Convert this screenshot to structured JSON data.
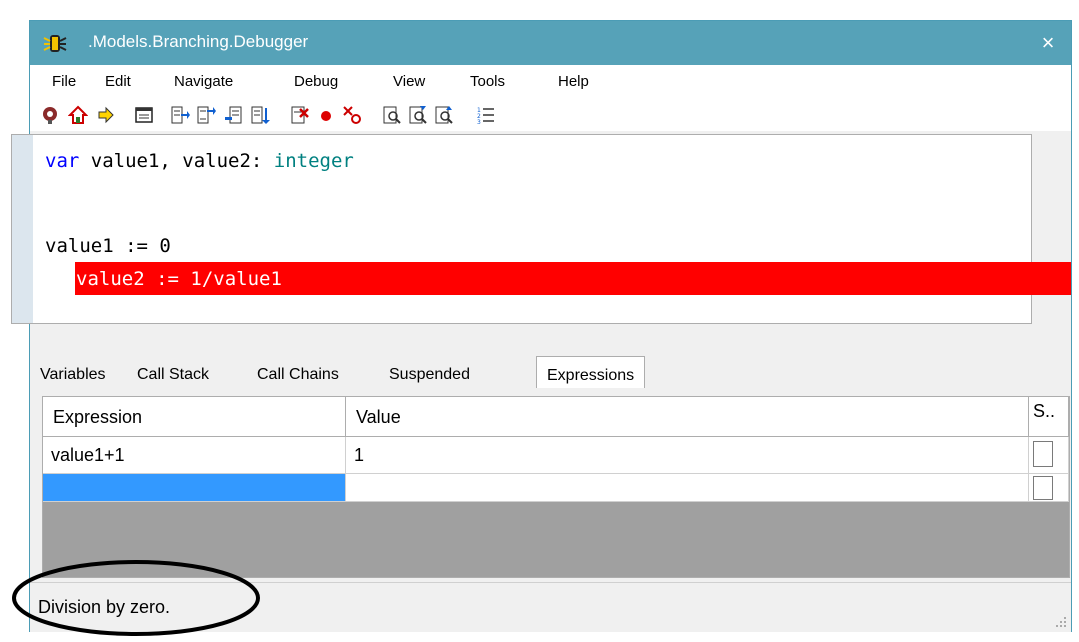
{
  "window": {
    "title": ".Models.Branching.Debugger",
    "close": "×"
  },
  "menu": [
    "File",
    "Edit",
    "Navigate",
    "Debug",
    "View",
    "Tools",
    "Help"
  ],
  "toolbar": [
    "breakpoint-icon",
    "home-icon",
    "run-arrow-icon",
    "window-icon",
    "step-into-icon",
    "step-over-icon",
    "step-out-icon",
    "run-to-cursor-icon",
    "stop-icon",
    "breakpoint-dot-icon",
    "clear-breakpoints-icon",
    "find-icon",
    "find-next-icon",
    "find-prev-icon",
    "list-icon"
  ],
  "code": {
    "line1": {
      "kw": "var",
      "mid": " value1, value2: ",
      "type": "integer"
    },
    "line3": "value1 := 0",
    "line4": "value2 := 1/value1"
  },
  "tabs": [
    "Variables",
    "Call Stack",
    "Call Chains",
    "Suspended",
    "Expressions"
  ],
  "active_tab": "Expressions",
  "grid": {
    "headers": [
      "Expression",
      "Value",
      "S.."
    ],
    "rows": [
      {
        "expression": "value1+1",
        "value": "1",
        "checked": false
      },
      {
        "expression": "",
        "value": "",
        "checked": false
      }
    ]
  },
  "status": "Division by zero.",
  "colors": {
    "titlebar": "#56a2b8",
    "error_line": "#ff0000",
    "selection": "#3399ff"
  }
}
